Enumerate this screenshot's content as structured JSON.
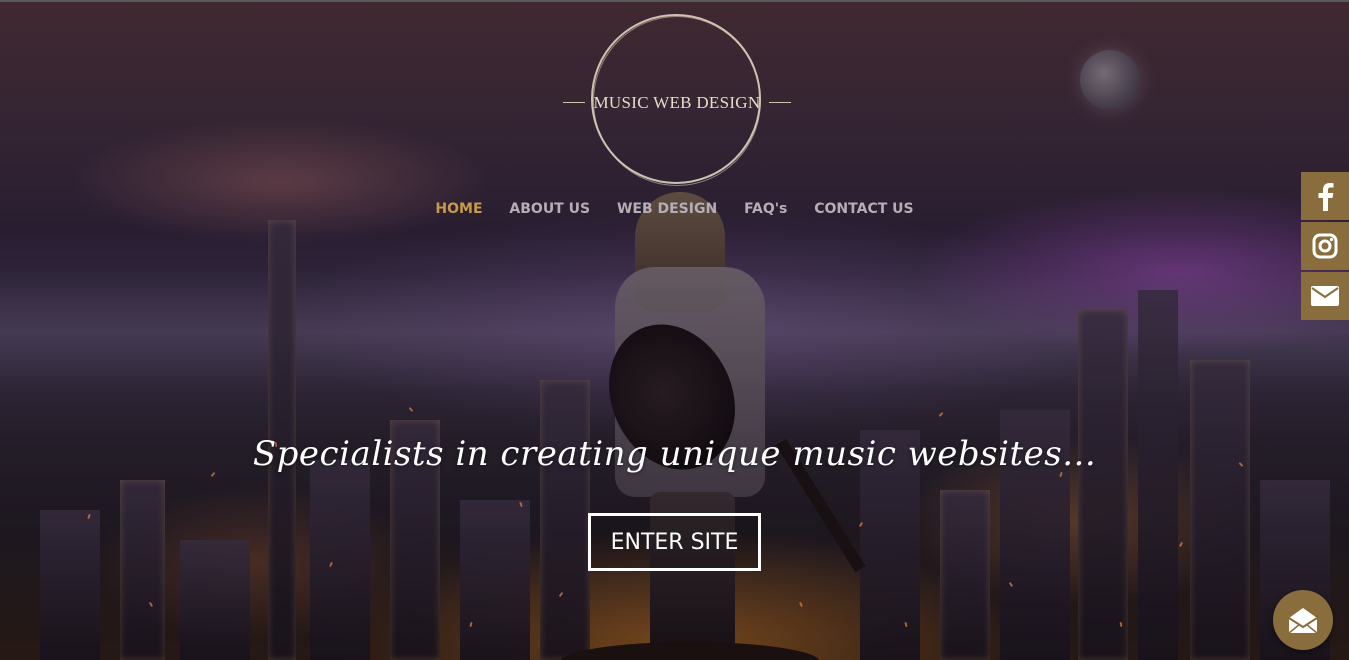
{
  "logo": {
    "text": "MUSIC WEB DESIGN"
  },
  "nav": {
    "items": [
      {
        "label": "HOME",
        "active": true
      },
      {
        "label": "ABOUT US",
        "active": false
      },
      {
        "label": "WEB DESIGN",
        "active": false
      },
      {
        "label": "FAQ's",
        "active": false
      },
      {
        "label": "CONTACT US",
        "active": false
      }
    ]
  },
  "social": {
    "items": [
      {
        "icon": "facebook-icon"
      },
      {
        "icon": "instagram-icon"
      },
      {
        "icon": "mail-icon"
      }
    ]
  },
  "hero": {
    "tagline": "Specialists in creating unique music websites...",
    "button_label": "ENTER SITE"
  },
  "floating_contact": {
    "icon": "open-envelope-icon"
  },
  "colors": {
    "accent": "#8a6d3c",
    "nav_active": "#c79a4a",
    "nav_text": "#b5aeb6",
    "logo": "#cfc3b0"
  }
}
